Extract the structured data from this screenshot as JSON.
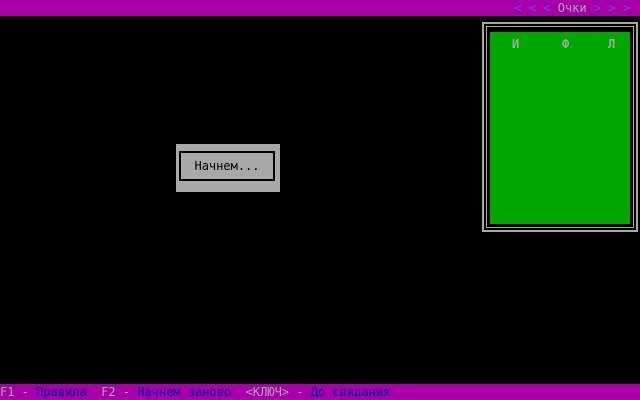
{
  "top_bar": {
    "arrows_left": "< < <",
    "title": "Очки",
    "arrows_right": "> > >"
  },
  "score_panel": {
    "columns": [
      "И",
      "Ф",
      "Л"
    ]
  },
  "dialog": {
    "text": "Начнем..."
  },
  "help_bar": {
    "f1_key": "F1",
    "sep1": " - ",
    "f1_action": "Правила",
    "f2_key": "F2",
    "sep2": " - ",
    "f2_action": "Начнем заново",
    "esc_key": "<КЛЮЧ>",
    "sep3": " - ",
    "esc_action": "До свидания"
  },
  "colors": {
    "bar": "#a800a8",
    "panel": "#00a800",
    "dialog": "#a8a8a8",
    "background": "#000000"
  }
}
